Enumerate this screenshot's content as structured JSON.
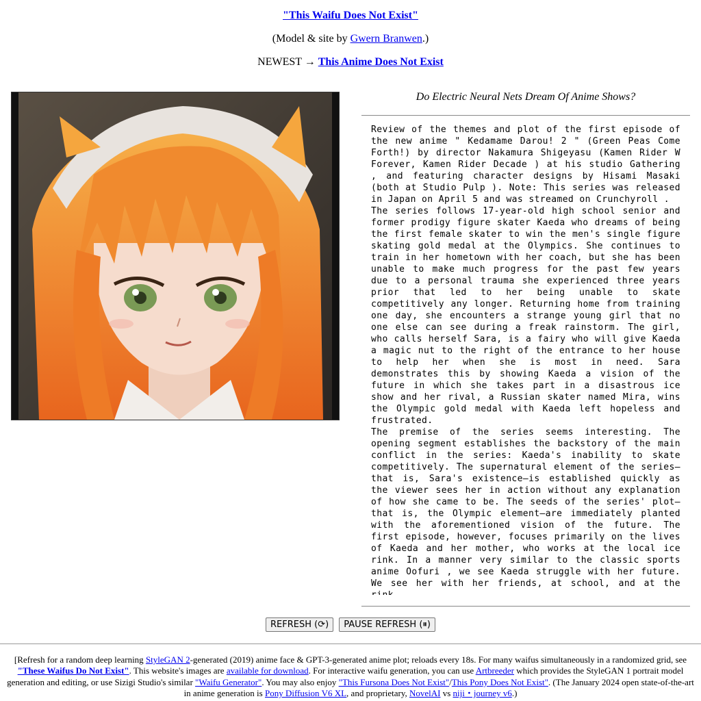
{
  "header": {
    "title_link": "\"This Waifu Does Not Exist\"",
    "credit_prefix": "(Model & site by ",
    "credit_link": "Gwern Branwen",
    "credit_suffix": ".)",
    "newest_prefix": "NEWEST → ",
    "newest_link": "This Anime Does Not Exist"
  },
  "portrait": {
    "icon": "anime-waifu-portrait",
    "hair_color": "#f07a2a",
    "skin_color": "#f6dccd",
    "eye_color": "#7a9a55"
  },
  "plot": {
    "heading": "Do Electric Neural Nets Dream Of Anime Shows?",
    "paragraphs": [
      "Review of the themes and plot of the first episode of the new anime \" Kedamame Darou! 2 \" (Green Peas Come Forth!) by director Nakamura Shigeyasu (Kamen Rider W Forever, Kamen Rider Decade ) at his studio Gathering , and featuring character designs by Hisami Masaki (both at Studio Pulp ). Note: This series was released in Japan on April 5 and was streamed on Crunchyroll .",
      "The series follows 17-year-old high school senior and former prodigy figure skater Kaeda who dreams of being the first female skater to win the men's single figure skating gold medal at the Olympics. She continues to train in her hometown with her coach, but she has been unable to make much progress for the past few years due to a personal trauma she experienced three years prior that led to her being unable to skate competitively any longer. Returning home from training one day, she encounters a strange young girl that no one else can see during a freak rainstorm. The girl, who calls herself Sara, is a fairy who will give Kaeda a magic nut to the right of the entrance to her house to help her when she is most in need. Sara demonstrates this by showing Kaeda a vision of the future in which she takes part in a disastrous ice show and her rival, a Russian skater named Mira, wins the Olympic gold medal with Kaeda left hopeless and frustrated.",
      "The premise of the series seems interesting. The opening segment establishes the backstory of the main conflict in the series: Kaeda's inability to skate competitively. The supernatural element of the series—that is, Sara's existence—is established quickly as the viewer sees her in action without any explanation of how she came to be. The seeds of the series' plot—that is, the Olympic element—are immediately planted with the aforementioned vision of the future. The first episode, however, focuses primarily on the lives of Kaeda and her mother, who works at the local ice rink. In a manner very similar to the classic sports anime Oofuri , we see Kaeda struggle with her future. We see her with her friends, at school, and at the rink."
    ]
  },
  "controls": {
    "refresh_label": "REFRESH (⟳)",
    "pause_label": "PAUSE REFRESH (⏸)"
  },
  "footer": {
    "t1": "[Refresh for a random deep learning ",
    "l1": "StyleGAN 2",
    "t2": "-generated (2019) anime face & GPT-3-generated anime plot; reloads every 18s. For many waifus simultaneously in a randomized grid, see ",
    "l2": "\"These Waifus Do Not Exist\"",
    "t3": ". This website's images are ",
    "l3": "available for download",
    "t4": ". For interactive waifu generation, you can use ",
    "l4": "Artbreeder",
    "t5": " which provides the StyleGAN 1 portrait model generation and editing, or use Sizigi Studio's similar ",
    "l5": "\"Waifu Generator\"",
    "t6": ". You may also enjoy ",
    "l6": "\"This Fursona Does Not Exist\"",
    "t7": "/",
    "l7": "This Pony Does Not Exist\"",
    "t8": ". (The January 2024 open state-of-the-art in anime generation is ",
    "l8": "Pony Diffusion V6 XL",
    "t9": ", and proprietary, ",
    "l9": "NovelAI",
    "t10": " vs ",
    "l10": "niji・journey v6",
    "t11": ".)"
  }
}
